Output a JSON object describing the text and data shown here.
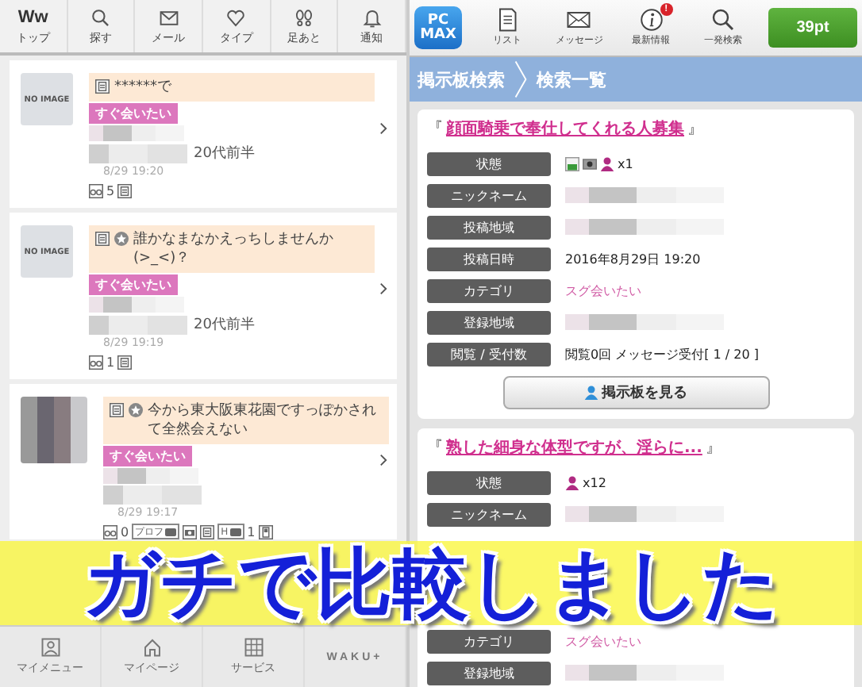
{
  "left_app": {
    "nav": [
      {
        "label": "トップ"
      },
      {
        "label": "探す"
      },
      {
        "label": "メール"
      },
      {
        "label": "タイプ"
      },
      {
        "label": "足あと"
      },
      {
        "label": "通知"
      }
    ],
    "logo": "Ww",
    "posts": [
      {
        "thumb": {
          "kind": "no_image",
          "text": "NO IMAGE"
        },
        "starred": false,
        "message": "******で",
        "badge": "すぐ会いたい",
        "age": "20代前半",
        "time": "8/29 19:20",
        "stats": [
          {
            "kind": "views",
            "text": "5"
          },
          {
            "kind": "doc"
          }
        ]
      },
      {
        "thumb": {
          "kind": "no_image",
          "text": "NO IMAGE"
        },
        "starred": true,
        "message": "誰かなまなかえっちしませんか(>_<)？",
        "badge": "すぐ会いたい",
        "age": "20代前半",
        "time": "8/29 19:19",
        "stats": [
          {
            "kind": "views",
            "text": "1"
          },
          {
            "kind": "doc"
          }
        ]
      },
      {
        "thumb": {
          "kind": "photo"
        },
        "starred": true,
        "message": "今から東大阪東花園ですっぽかされて全然会えない",
        "badge": "すぐ会いたい",
        "time": "8/29 19:17",
        "stats": [
          {
            "kind": "views",
            "text": "0"
          },
          {
            "kind": "tag_photo",
            "text": "プロフ"
          },
          {
            "kind": "photo"
          },
          {
            "kind": "doc"
          },
          {
            "kind": "tag_photo",
            "text": "H"
          },
          {
            "kind": "count",
            "text": "1"
          },
          {
            "kind": "phone"
          }
        ]
      }
    ],
    "bottom_nav": [
      {
        "label": "マイメニュー"
      },
      {
        "label": "マイページ"
      },
      {
        "label": "サービス"
      },
      {
        "label": "WAKU+"
      }
    ]
  },
  "right_app": {
    "logo_lines": [
      "PC",
      "MAX"
    ],
    "nav": [
      {
        "label": "リスト"
      },
      {
        "label": "メッセージ"
      },
      {
        "label": "最新情報",
        "badge": "!"
      },
      {
        "label": "一発検索"
      }
    ],
    "points": "39pt",
    "breadcrumb": [
      "掲示板検索",
      "検索一覧"
    ],
    "posts": [
      {
        "open_quote": "『",
        "title": "顔面騎乗で奉仕してくれる人募集",
        "close_quote": "』",
        "rows": [
          {
            "label": "状態",
            "kind": "status",
            "icons": [
              {
                "kind": "doc"
              },
              {
                "kind": "photo"
              },
              {
                "kind": "person"
              }
            ],
            "value": "x1"
          },
          {
            "label": "ニックネーム",
            "kind": "blurred"
          },
          {
            "label": "投稿地域",
            "kind": "blurred"
          },
          {
            "label": "投稿日時",
            "kind": "text",
            "value": "2016年8月29日 19:20"
          },
          {
            "label": "カテゴリ",
            "kind": "category",
            "value": "スグ会いたい"
          },
          {
            "label": "登録地域",
            "kind": "blurred"
          },
          {
            "label": "閲覧 / 受付数",
            "kind": "text",
            "value": "閲覧0回 メッセージ受付[ 1 / 20 ]"
          }
        ],
        "button": "掲示板を見る"
      },
      {
        "open_quote": "『",
        "title": "熟した細身な体型ですが、淫らに...",
        "close_quote": "』",
        "rows": [
          {
            "label": "状態",
            "kind": "status",
            "icons": [
              {
                "kind": "person"
              }
            ],
            "value": "x12"
          },
          {
            "label": "ニックネーム",
            "kind": "blurred"
          },
          {
            "kind": "hidden"
          },
          {
            "kind": "hidden"
          },
          {
            "label": "カテゴリ",
            "kind": "category",
            "value": "スグ会いたい"
          },
          {
            "label": "登録地域",
            "kind": "blurred"
          }
        ]
      }
    ]
  },
  "banner": {
    "text": "ガチで比較しました"
  }
}
